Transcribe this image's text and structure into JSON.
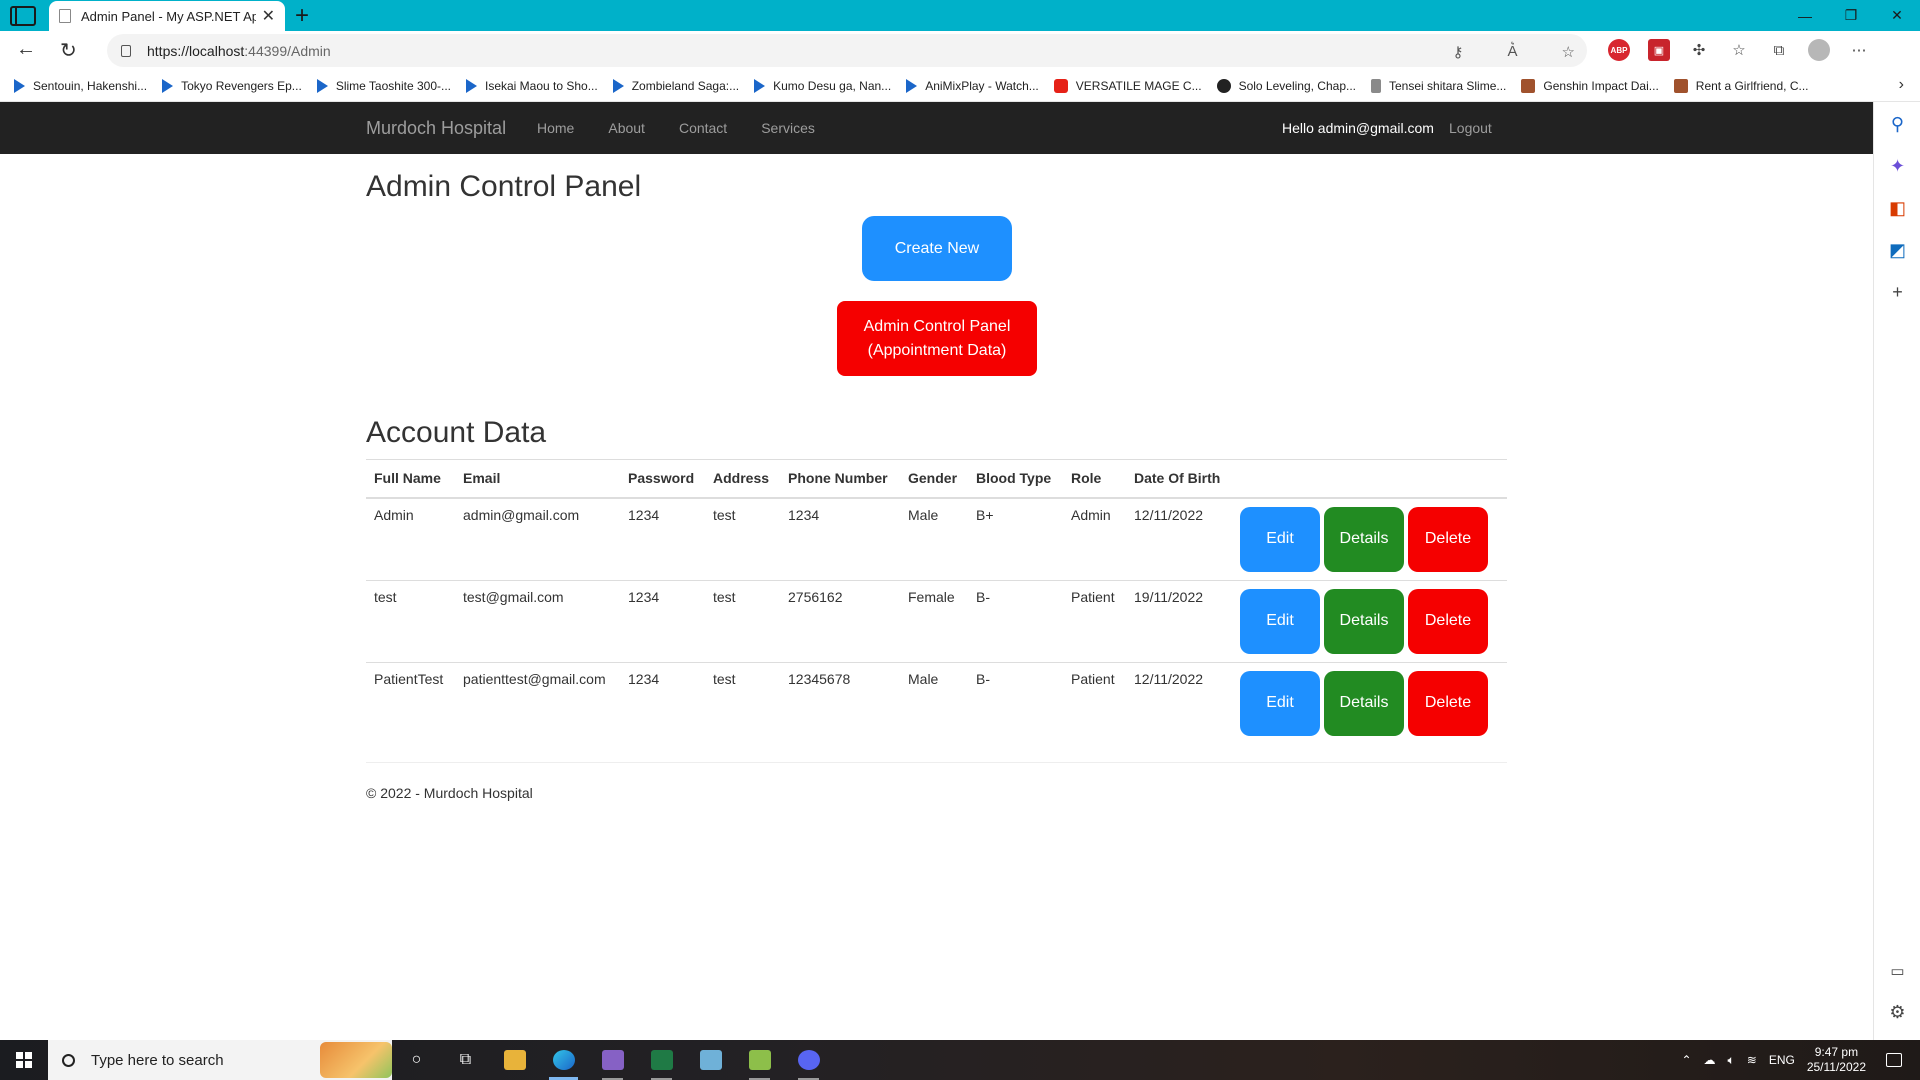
{
  "browser": {
    "tab_title": "Admin Panel - My ASP.NET Appli",
    "url_host": "https://localhost",
    "url_rest": ":44399/Admin",
    "bookmarks": [
      {
        "label": "Sentouin, Hakenshi...",
        "icon": "play"
      },
      {
        "label": "Tokyo Revengers Ep...",
        "icon": "play"
      },
      {
        "label": "Slime Taoshite 300-...",
        "icon": "play"
      },
      {
        "label": "Isekai Maou to Sho...",
        "icon": "play"
      },
      {
        "label": "Zombieland Saga:...",
        "icon": "play"
      },
      {
        "label": "Kumo Desu ga, Nan...",
        "icon": "play"
      },
      {
        "label": "AniMixPlay - Watch...",
        "icon": "play"
      },
      {
        "label": "VERSATILE MAGE C...",
        "icon": "yt"
      },
      {
        "label": "Solo Leveling, Chap...",
        "icon": "round"
      },
      {
        "label": "Tensei shitara Slime...",
        "icon": "lockb"
      },
      {
        "label": "Genshin Impact Dai...",
        "icon": "img"
      },
      {
        "label": "Rent a Girlfriend, C...",
        "icon": "img"
      }
    ],
    "ext_abp": "ABP"
  },
  "navbar": {
    "brand": "Murdoch Hospital",
    "links": [
      "Home",
      "About",
      "Contact",
      "Services"
    ],
    "hello": "Hello admin@gmail.com",
    "logout": "Logout"
  },
  "main": {
    "title": "Admin Control Panel",
    "create_new": "Create New",
    "appt_line1": "Admin Control Panel",
    "appt_line2": "(Appointment Data)",
    "section_title": "Account Data",
    "columns": [
      "Full Name",
      "Email",
      "Password",
      "Address",
      "Phone Number",
      "Gender",
      "Blood Type",
      "Role",
      "Date Of Birth"
    ],
    "rows": [
      [
        "Admin",
        "admin@gmail.com",
        "1234",
        "test",
        "1234",
        "Male",
        "B+",
        "Admin",
        "12/11/2022"
      ],
      [
        "test",
        "test@gmail.com",
        "1234",
        "test",
        "2756162",
        "Female",
        "B-",
        "Patient",
        "19/11/2022"
      ],
      [
        "PatientTest",
        "patienttest@gmail.com",
        "1234",
        "test",
        "12345678",
        "Male",
        "B-",
        "Patient",
        "12/11/2022"
      ]
    ],
    "actions": {
      "edit": "Edit",
      "details": "Details",
      "delete": "Delete"
    }
  },
  "footer": "© 2022 - Murdoch Hospital",
  "taskbar": {
    "search_placeholder": "Type here to search",
    "lang": "ENG",
    "time": "9:47 pm",
    "date": "25/11/2022"
  },
  "colors": {
    "create_button": "#1e90ff",
    "appointment_button": "#f50000",
    "edit_button": "#1e90ff",
    "details_button": "#228b22",
    "delete_button": "#f50000",
    "navbar": "#222222",
    "titlebar": "#00b1c9"
  }
}
